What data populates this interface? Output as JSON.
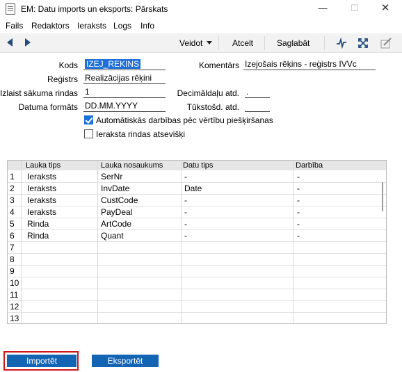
{
  "window": {
    "title": "EM: Datu imports un eksports: Pārskats",
    "minimize_glyph": "—",
    "maximize_glyph": "☐",
    "close_glyph": "✕"
  },
  "menu": [
    "Fails",
    "Redaktors",
    "Ieraksts",
    "Logs",
    "Info"
  ],
  "toolbar": {
    "create_label": "Veidot",
    "cancel_label": "Atcelt",
    "save_label": "Saglabāt",
    "icons": [
      "prev-record-icon",
      "next-record-icon",
      "activity-icon",
      "expand-icon",
      "edit-icon"
    ]
  },
  "form": {
    "code_label": "Kods",
    "code_value": "IZEJ_REKINS",
    "comment_label": "Komentārs",
    "comment_value": "Izejošais rēķins - reģistrs IVVc",
    "register_label": "Reģistrs",
    "register_value": "Realizācijas rēķini",
    "skip_rows_label": "Izlaist sākuma rindas",
    "skip_rows_value": "1",
    "decimal_label": "Decimāldaļu atd.",
    "decimal_value": ".",
    "date_format_label": "Datuma formāts",
    "date_format_value": "DD.MM.YYYY",
    "thousands_label": "Tūkstošd. atd.",
    "thousands_value": "",
    "auto_actions_label": "Automātiskās darbības pēc vērtību piešķiršanas",
    "auto_actions_checked": true,
    "separate_rows_label": "Ieraksta rindas atsevišķi",
    "separate_rows_checked": false
  },
  "grid": {
    "columns": [
      "Lauka tips",
      "Lauka nosaukums",
      "Datu tips",
      "Darbība"
    ],
    "rows": [
      {
        "n": "1",
        "type": "Ieraksts",
        "name": "SerNr",
        "dtype": "-",
        "action": "-"
      },
      {
        "n": "2",
        "type": "Ieraksts",
        "name": "InvDate",
        "dtype": "Date",
        "action": "-"
      },
      {
        "n": "3",
        "type": "Ieraksts",
        "name": "CustCode",
        "dtype": "-",
        "action": "-"
      },
      {
        "n": "4",
        "type": "Ieraksts",
        "name": "PayDeal",
        "dtype": "-",
        "action": "-"
      },
      {
        "n": "5",
        "type": "Rinda",
        "name": "ArtCode",
        "dtype": "-",
        "action": "-"
      },
      {
        "n": "6",
        "type": "Rinda",
        "name": "Quant",
        "dtype": "-",
        "action": "-"
      },
      {
        "n": "7",
        "type": "",
        "name": "",
        "dtype": "",
        "action": ""
      },
      {
        "n": "8",
        "type": "",
        "name": "",
        "dtype": "",
        "action": ""
      },
      {
        "n": "9",
        "type": "",
        "name": "",
        "dtype": "",
        "action": ""
      },
      {
        "n": "10",
        "type": "",
        "name": "",
        "dtype": "",
        "action": ""
      },
      {
        "n": "11",
        "type": "",
        "name": "",
        "dtype": "",
        "action": ""
      },
      {
        "n": "12",
        "type": "",
        "name": "",
        "dtype": "",
        "action": ""
      },
      {
        "n": "13",
        "type": "",
        "name": "",
        "dtype": "",
        "action": ""
      }
    ]
  },
  "buttons": {
    "import_label": "Importēt",
    "export_label": "Eksportēt"
  },
  "colors": {
    "accent": "#1464b4",
    "selection": "#1e6fd9",
    "focus_outline": "#d0161a"
  }
}
